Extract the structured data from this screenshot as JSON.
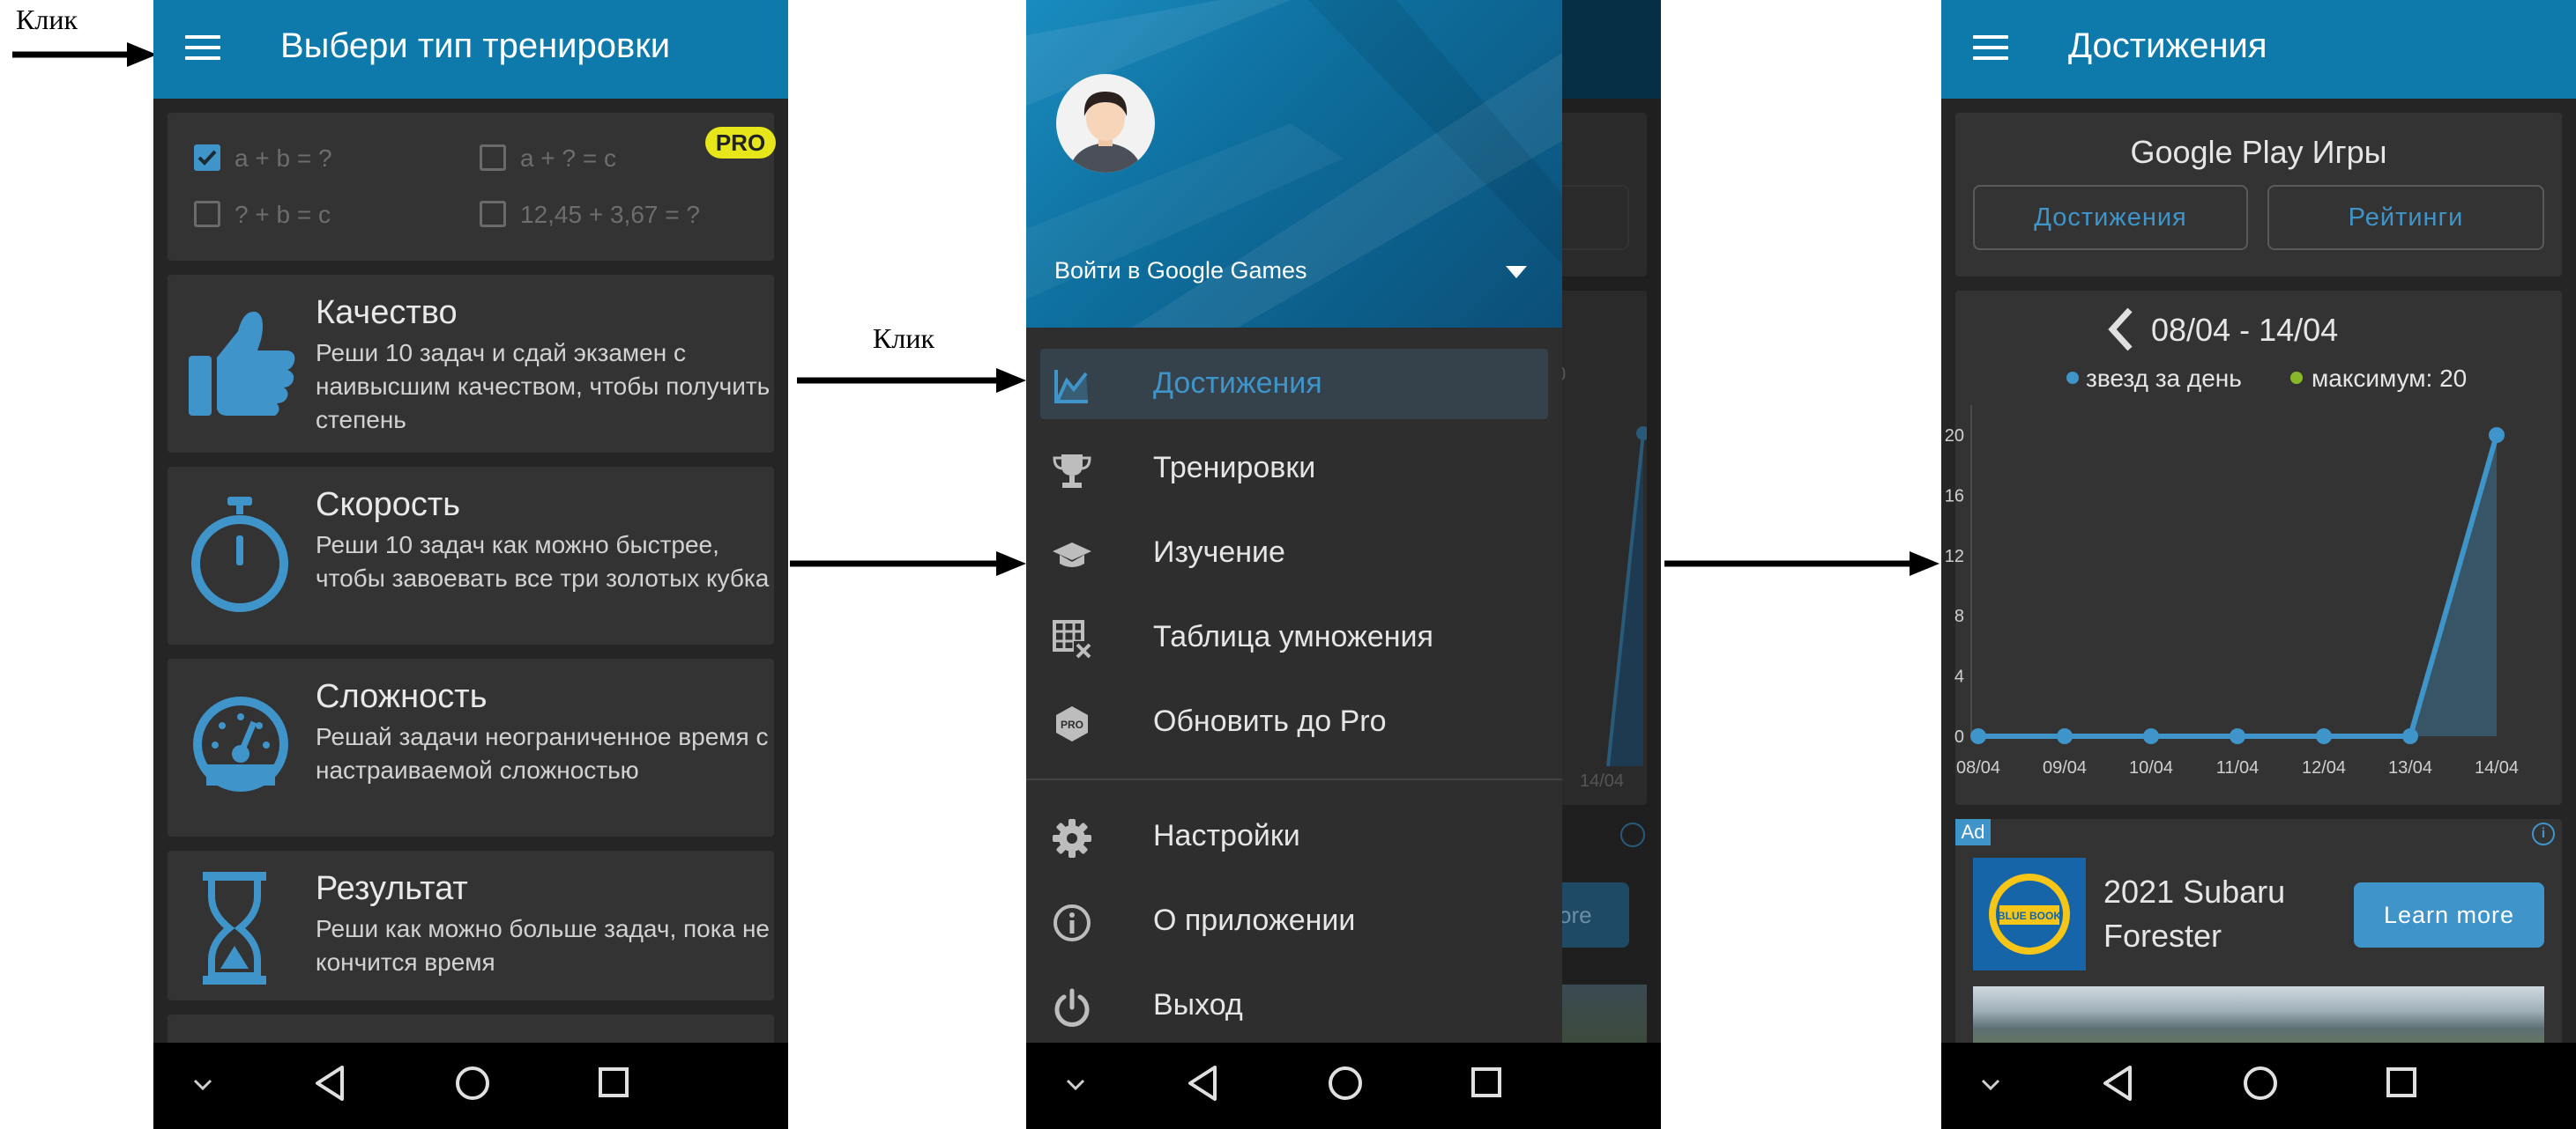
{
  "annotations": {
    "click1": "Клик",
    "click2": "Клик"
  },
  "screen1": {
    "title": "Выбери тип тренировки",
    "pro_badge": "PRO",
    "options": [
      {
        "label": "a + b = ?",
        "checked": true
      },
      {
        "label": "a + ? = c",
        "checked": false
      },
      {
        "label": "? + b = c",
        "checked": false
      },
      {
        "label": "12,45 + 3,67 = ?",
        "checked": false
      }
    ],
    "modes": [
      {
        "title": "Качество",
        "desc": "Реши 10 задач и сдай экзамен с наивысшим качеством, чтобы получить степень",
        "icon": "thumbs-up-icon"
      },
      {
        "title": "Скорость",
        "desc": "Реши 10 задач как можно быстрее, чтобы завоевать все три золотых кубка",
        "icon": "stopwatch-icon"
      },
      {
        "title": "Сложность",
        "desc": "Решай задачи неограниченное время с настраиваемой сложностью",
        "icon": "gauge-icon"
      },
      {
        "title": "Результат",
        "desc": "Реши как можно больше задач, пока не кончится время",
        "icon": "hourglass-icon"
      }
    ]
  },
  "screen2": {
    "account_label": "Войти в Google Games",
    "menu": [
      {
        "label": "Достижения",
        "icon": "chart-icon",
        "active": true
      },
      {
        "label": "Тренировки",
        "icon": "trophy-icon",
        "active": false
      },
      {
        "label": "Изучение",
        "icon": "graduation-cap-icon",
        "active": false
      },
      {
        "label": "Таблица умножения",
        "icon": "table-icon",
        "active": false
      },
      {
        "label": "Обновить до Pro",
        "icon": "pro-icon",
        "active": false
      }
    ],
    "menu2": [
      {
        "label": "Настройки",
        "icon": "gear-icon"
      },
      {
        "label": "О приложении",
        "icon": "info-icon"
      },
      {
        "label": "Выход",
        "icon": "power-icon"
      }
    ],
    "behind": {
      "xtick": "14/04",
      "more": "ore",
      "zero": "0"
    }
  },
  "screen3": {
    "title": "Достижения",
    "gp_title": "Google Play Игры",
    "btn_achievements": "Достижения",
    "btn_ratings": "Рейтинги",
    "week": "08/04 - 14/04",
    "ad": {
      "badge": "Ad",
      "title": "2021 Subaru Forester",
      "button": "Learn more",
      "logo_text": "BLUE BOOK"
    }
  },
  "chart_data": {
    "type": "line",
    "x": [
      "08/04",
      "09/04",
      "10/04",
      "11/04",
      "12/04",
      "13/04",
      "14/04"
    ],
    "series": [
      {
        "name": "звезд за день",
        "values": [
          0,
          0,
          0,
          0,
          0,
          0,
          20
        ],
        "color": "#3f94c9"
      }
    ],
    "legend": [
      "звезд за день",
      "максимум: 20"
    ],
    "legend_colors": [
      "#3f94c9",
      "#8ab72a"
    ],
    "yticks": [
      0,
      4,
      8,
      12,
      16,
      20
    ],
    "ylim": [
      0,
      20
    ],
    "grid": false,
    "legend_position": "top"
  },
  "colors": {
    "accent": "#0e7aab",
    "icon_blue": "#3f94c9",
    "pro_yellow": "#e6e61a",
    "card_bg": "#333333",
    "panel_bg": "#252526"
  }
}
